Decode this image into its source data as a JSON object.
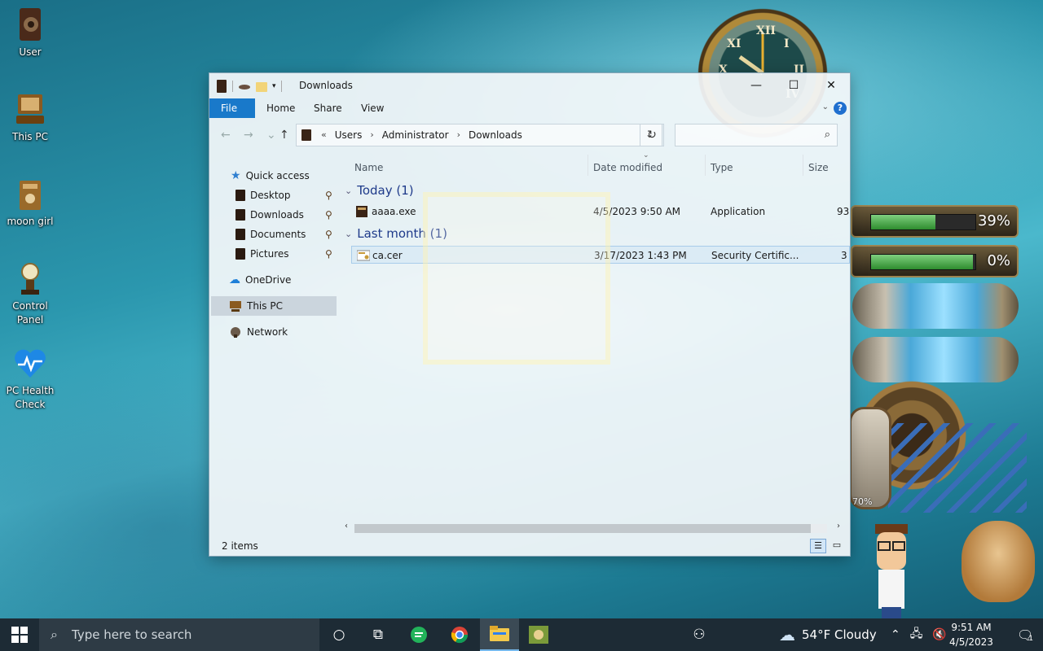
{
  "desktop": {
    "icons": [
      {
        "label": "User"
      },
      {
        "label": "This PC"
      },
      {
        "label": "moon girl"
      },
      {
        "label": "Control Panel"
      },
      {
        "label": "PC Health Check"
      }
    ],
    "widgets": {
      "meter1_pct": "39%",
      "meter1_fill": 0.62,
      "meter2_pct": "0%",
      "meter2_fill": 0.98,
      "gauge_pct": "70%"
    }
  },
  "window": {
    "title": "Downloads",
    "controls": {
      "minimize": "—",
      "maximize": "☐",
      "close": "✕"
    },
    "ribbon": {
      "tabs": [
        "File",
        "Home",
        "Share",
        "View"
      ]
    },
    "address": {
      "crumbs": [
        "Users",
        "Administrator",
        "Downloads"
      ],
      "overflow": "«"
    },
    "search_placeholder": "",
    "nav": {
      "quick_access": "Quick access",
      "quick_items": [
        "Desktop",
        "Downloads",
        "Documents",
        "Pictures"
      ],
      "onedrive": "OneDrive",
      "this_pc": "This PC",
      "network": "Network"
    },
    "columns": {
      "name": "Name",
      "date": "Date modified",
      "type": "Type",
      "size": "Size"
    },
    "groups": [
      {
        "label": "Today (1)",
        "files": [
          {
            "name": "aaaa.exe",
            "date": "4/5/2023 9:50 AM",
            "type": "Application",
            "size": "93"
          }
        ]
      },
      {
        "label": "Last month (1)",
        "files": [
          {
            "name": "ca.cer",
            "date": "3/17/2023 1:43 PM",
            "type": "Security Certific...",
            "size": "3"
          }
        ]
      }
    ],
    "status": {
      "count": "2 items"
    }
  },
  "taskbar": {
    "search_placeholder": "Type here to search",
    "weather": "54°F  Cloudy",
    "time": "9:51 AM",
    "date": "4/5/2023",
    "notification_count": "1"
  },
  "colors": {
    "accent": "#1979ca",
    "taskbar": "#1d2b35",
    "group_header": "#1e3a8a"
  }
}
